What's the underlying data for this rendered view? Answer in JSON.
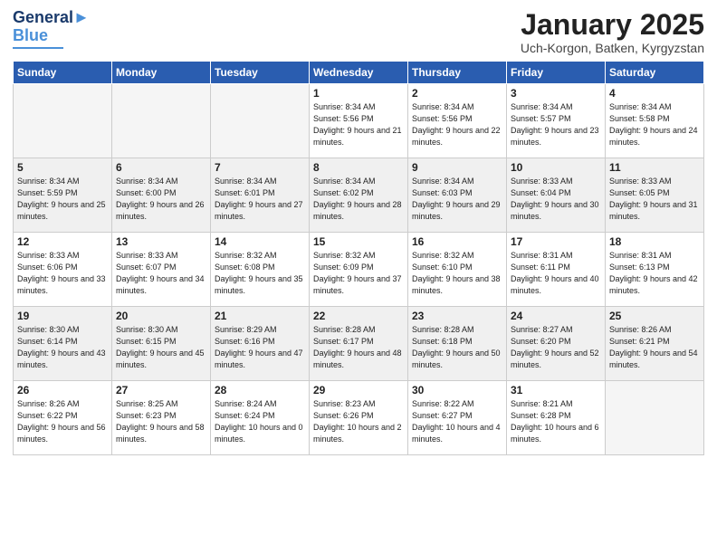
{
  "logo": {
    "line1": "General",
    "line2": "Blue"
  },
  "title": "January 2025",
  "location": "Uch-Korgon, Batken, Kyrgyzstan",
  "weekdays": [
    "Sunday",
    "Monday",
    "Tuesday",
    "Wednesday",
    "Thursday",
    "Friday",
    "Saturday"
  ],
  "weeks": [
    [
      {
        "day": "",
        "empty": true
      },
      {
        "day": "",
        "empty": true
      },
      {
        "day": "",
        "empty": true
      },
      {
        "day": "1",
        "sunrise": "8:34 AM",
        "sunset": "5:56 PM",
        "daylight": "9 hours and 21 minutes."
      },
      {
        "day": "2",
        "sunrise": "8:34 AM",
        "sunset": "5:56 PM",
        "daylight": "9 hours and 22 minutes."
      },
      {
        "day": "3",
        "sunrise": "8:34 AM",
        "sunset": "5:57 PM",
        "daylight": "9 hours and 23 minutes."
      },
      {
        "day": "4",
        "sunrise": "8:34 AM",
        "sunset": "5:58 PM",
        "daylight": "9 hours and 24 minutes."
      }
    ],
    [
      {
        "day": "5",
        "sunrise": "8:34 AM",
        "sunset": "5:59 PM",
        "daylight": "9 hours and 25 minutes."
      },
      {
        "day": "6",
        "sunrise": "8:34 AM",
        "sunset": "6:00 PM",
        "daylight": "9 hours and 26 minutes."
      },
      {
        "day": "7",
        "sunrise": "8:34 AM",
        "sunset": "6:01 PM",
        "daylight": "9 hours and 27 minutes."
      },
      {
        "day": "8",
        "sunrise": "8:34 AM",
        "sunset": "6:02 PM",
        "daylight": "9 hours and 28 minutes."
      },
      {
        "day": "9",
        "sunrise": "8:34 AM",
        "sunset": "6:03 PM",
        "daylight": "9 hours and 29 minutes."
      },
      {
        "day": "10",
        "sunrise": "8:33 AM",
        "sunset": "6:04 PM",
        "daylight": "9 hours and 30 minutes."
      },
      {
        "day": "11",
        "sunrise": "8:33 AM",
        "sunset": "6:05 PM",
        "daylight": "9 hours and 31 minutes."
      }
    ],
    [
      {
        "day": "12",
        "sunrise": "8:33 AM",
        "sunset": "6:06 PM",
        "daylight": "9 hours and 33 minutes."
      },
      {
        "day": "13",
        "sunrise": "8:33 AM",
        "sunset": "6:07 PM",
        "daylight": "9 hours and 34 minutes."
      },
      {
        "day": "14",
        "sunrise": "8:32 AM",
        "sunset": "6:08 PM",
        "daylight": "9 hours and 35 minutes."
      },
      {
        "day": "15",
        "sunrise": "8:32 AM",
        "sunset": "6:09 PM",
        "daylight": "9 hours and 37 minutes."
      },
      {
        "day": "16",
        "sunrise": "8:32 AM",
        "sunset": "6:10 PM",
        "daylight": "9 hours and 38 minutes."
      },
      {
        "day": "17",
        "sunrise": "8:31 AM",
        "sunset": "6:11 PM",
        "daylight": "9 hours and 40 minutes."
      },
      {
        "day": "18",
        "sunrise": "8:31 AM",
        "sunset": "6:13 PM",
        "daylight": "9 hours and 42 minutes."
      }
    ],
    [
      {
        "day": "19",
        "sunrise": "8:30 AM",
        "sunset": "6:14 PM",
        "daylight": "9 hours and 43 minutes."
      },
      {
        "day": "20",
        "sunrise": "8:30 AM",
        "sunset": "6:15 PM",
        "daylight": "9 hours and 45 minutes."
      },
      {
        "day": "21",
        "sunrise": "8:29 AM",
        "sunset": "6:16 PM",
        "daylight": "9 hours and 47 minutes."
      },
      {
        "day": "22",
        "sunrise": "8:28 AM",
        "sunset": "6:17 PM",
        "daylight": "9 hours and 48 minutes."
      },
      {
        "day": "23",
        "sunrise": "8:28 AM",
        "sunset": "6:18 PM",
        "daylight": "9 hours and 50 minutes."
      },
      {
        "day": "24",
        "sunrise": "8:27 AM",
        "sunset": "6:20 PM",
        "daylight": "9 hours and 52 minutes."
      },
      {
        "day": "25",
        "sunrise": "8:26 AM",
        "sunset": "6:21 PM",
        "daylight": "9 hours and 54 minutes."
      }
    ],
    [
      {
        "day": "26",
        "sunrise": "8:26 AM",
        "sunset": "6:22 PM",
        "daylight": "9 hours and 56 minutes."
      },
      {
        "day": "27",
        "sunrise": "8:25 AM",
        "sunset": "6:23 PM",
        "daylight": "9 hours and 58 minutes."
      },
      {
        "day": "28",
        "sunrise": "8:24 AM",
        "sunset": "6:24 PM",
        "daylight": "10 hours and 0 minutes."
      },
      {
        "day": "29",
        "sunrise": "8:23 AM",
        "sunset": "6:26 PM",
        "daylight": "10 hours and 2 minutes."
      },
      {
        "day": "30",
        "sunrise": "8:22 AM",
        "sunset": "6:27 PM",
        "daylight": "10 hours and 4 minutes."
      },
      {
        "day": "31",
        "sunrise": "8:21 AM",
        "sunset": "6:28 PM",
        "daylight": "10 hours and 6 minutes."
      },
      {
        "day": "",
        "empty": true
      }
    ]
  ]
}
